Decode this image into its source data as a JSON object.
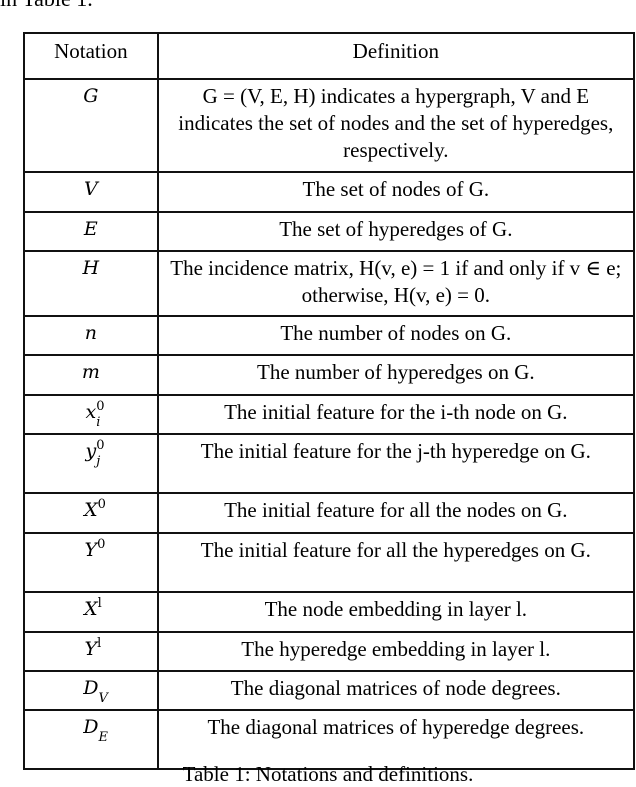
{
  "intro_text": "in Table 1.",
  "table": {
    "headers": [
      "Notation",
      "Definition"
    ],
    "rows": [
      {
        "notation": "G",
        "notation_sup": "",
        "notation_sub": "",
        "definition": "G = (V, E, H) indicates a hypergraph, V and E indicates the set of nodes and the set of hyperedges, respectively."
      },
      {
        "notation": "V",
        "notation_sup": "",
        "notation_sub": "",
        "definition": "The set of nodes of G."
      },
      {
        "notation": "E",
        "notation_sup": "",
        "notation_sub": "",
        "definition": "The set of hyperedges of G."
      },
      {
        "notation": "H",
        "notation_sup": "",
        "notation_sub": "",
        "definition": "The incidence matrix, H(v, e) = 1 if and only if v ∈ e; otherwise, H(v, e) = 0."
      },
      {
        "notation": "n",
        "notation_sup": "",
        "notation_sub": "",
        "definition": "The number of nodes on G."
      },
      {
        "notation": "m",
        "notation_sup": "",
        "notation_sub": "",
        "definition": "The number of hyperedges on G."
      },
      {
        "notation": "x",
        "notation_sup": "0",
        "notation_sub": "i",
        "definition": "The initial feature for the i-th node on G."
      },
      {
        "notation": "y",
        "notation_sup": "0",
        "notation_sub": "j",
        "definition": "The initial feature for the j-th hyperedge on G."
      },
      {
        "notation": "X",
        "notation_sup": "0",
        "notation_sub": "",
        "definition": "The initial feature for all the nodes on G."
      },
      {
        "notation": "Y",
        "notation_sup": "0",
        "notation_sub": "",
        "definition": "The initial feature for all the hyperedges on G."
      },
      {
        "notation": "X",
        "notation_sup": "l",
        "notation_sub": "",
        "definition": "The node embedding in layer l."
      },
      {
        "notation": "Y",
        "notation_sup": "l",
        "notation_sub": "",
        "definition": "The hyperedge embedding in layer l."
      },
      {
        "notation": "D",
        "notation_sup": "",
        "notation_sub": "V",
        "definition": "The diagonal matrices of node degrees."
      },
      {
        "notation": "D",
        "notation_sup": "",
        "notation_sub": "E",
        "definition": "The diagonal matrices of hyperedge degrees."
      }
    ]
  },
  "caption": "Table 1: Notations and definitions."
}
